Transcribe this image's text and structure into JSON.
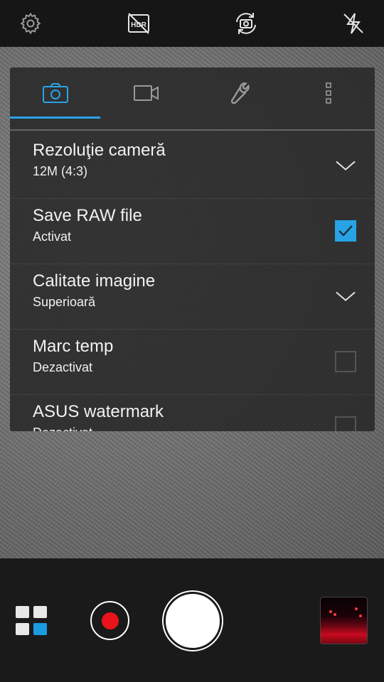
{
  "topbar": {
    "icons": [
      "settings-gear-icon",
      "hdr-off-icon",
      "switch-camera-icon",
      "flash-off-icon"
    ]
  },
  "settings_panel": {
    "tabs": [
      {
        "icon": "camera-icon",
        "active": true
      },
      {
        "icon": "video-camera-icon",
        "active": false
      },
      {
        "icon": "wrench-icon",
        "active": false
      },
      {
        "icon": "more-vertical-icon",
        "active": false
      }
    ],
    "accent_color": "#27a3e6",
    "rows": [
      {
        "title": "Rezoluţie cameră",
        "value": "12M (4:3)",
        "control": "dropdown"
      },
      {
        "title": "Save RAW file",
        "value": "Activat",
        "control": "checkbox",
        "checked": true
      },
      {
        "title": "Calitate imagine",
        "value": "Superioară",
        "control": "dropdown"
      },
      {
        "title": "Marc temp",
        "value": "Dezactivat",
        "control": "checkbox",
        "checked": false
      },
      {
        "title": "ASUS watermark",
        "value": "Dezactivat",
        "control": "checkbox",
        "checked": false
      }
    ]
  },
  "bottombar": {
    "mode_icon": "camera-modes-grid-icon",
    "record_color": "#e8131b",
    "shutter_color": "#ffffff",
    "gallery_thumbnail": "last-photo-thumbnail"
  }
}
